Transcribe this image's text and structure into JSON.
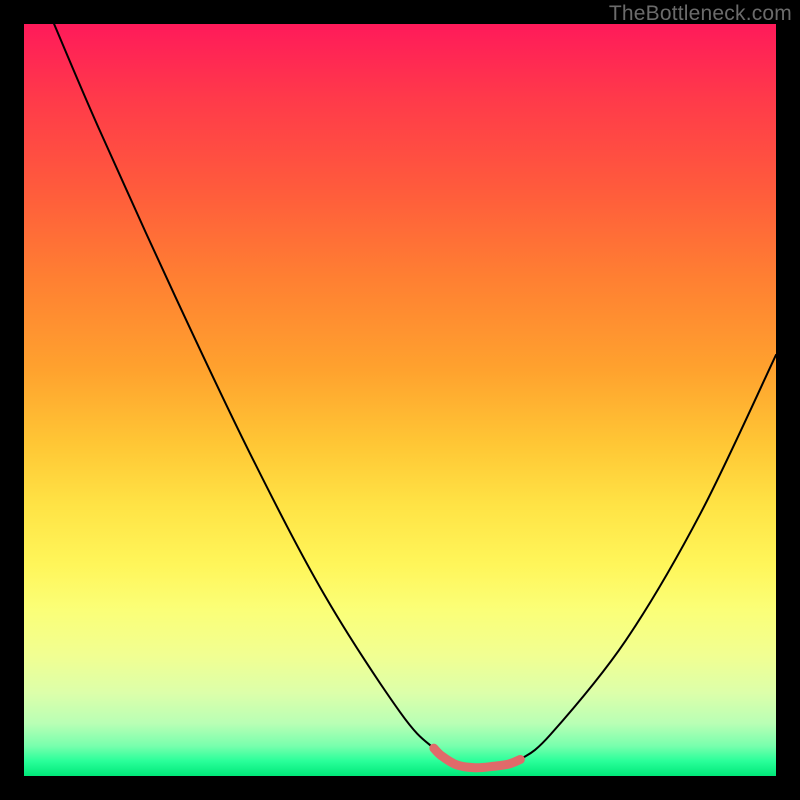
{
  "watermark": "TheBottleneck.com",
  "chart_data": {
    "type": "line",
    "title": "",
    "xlabel": "",
    "ylabel": "",
    "xlim": [
      0,
      1
    ],
    "ylim": [
      0,
      1
    ],
    "series": [
      {
        "name": "main-curve",
        "color": "#000000",
        "stroke_width": 2,
        "x": [
          0.04,
          0.1,
          0.2,
          0.3,
          0.4,
          0.5,
          0.545,
          0.58,
          0.6,
          0.64,
          0.66,
          0.7,
          0.8,
          0.9,
          1.0
        ],
        "y": [
          1.0,
          0.86,
          0.64,
          0.43,
          0.24,
          0.085,
          0.037,
          0.017,
          0.011,
          0.013,
          0.022,
          0.055,
          0.18,
          0.35,
          0.56
        ]
      },
      {
        "name": "valley-highlight",
        "color": "#e06a6a",
        "stroke_width": 9,
        "x": [
          0.545,
          0.555,
          0.575,
          0.6,
          0.625,
          0.645,
          0.66
        ],
        "y": [
          0.037,
          0.027,
          0.015,
          0.011,
          0.013,
          0.016,
          0.022
        ]
      }
    ],
    "annotations": [
      {
        "text": "TheBottleneck.com",
        "x": 0.995,
        "y": 0.998,
        "ha": "right",
        "va": "top",
        "color": "#6b6b6b"
      }
    ]
  }
}
